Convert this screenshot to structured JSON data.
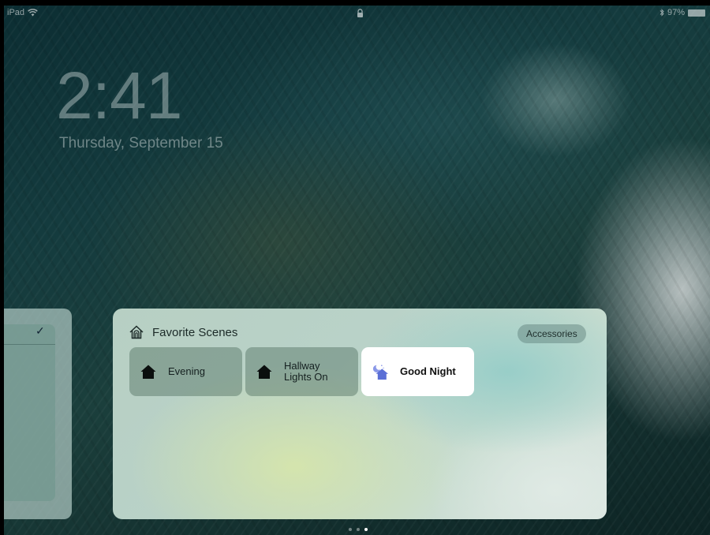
{
  "status_bar": {
    "device": "iPad",
    "battery": "97%"
  },
  "lock_screen": {
    "time": "2:41",
    "date": "Thursday, September 15"
  },
  "widget": {
    "title": "Favorite Scenes",
    "accessories_label": "Accessories",
    "scenes": [
      {
        "label": "Evening",
        "icon": "house-icon",
        "active": false
      },
      {
        "label": "Hallway Lights On",
        "icon": "house-icon",
        "active": false
      },
      {
        "label": "Good Night",
        "icon": "house-moon-icon",
        "active": true
      }
    ]
  },
  "page_indicator": {
    "pages": 3,
    "current": 3
  },
  "colors": {
    "active_scene_bg": "#ffffff",
    "good_night_icon": "#5b6fd6"
  }
}
